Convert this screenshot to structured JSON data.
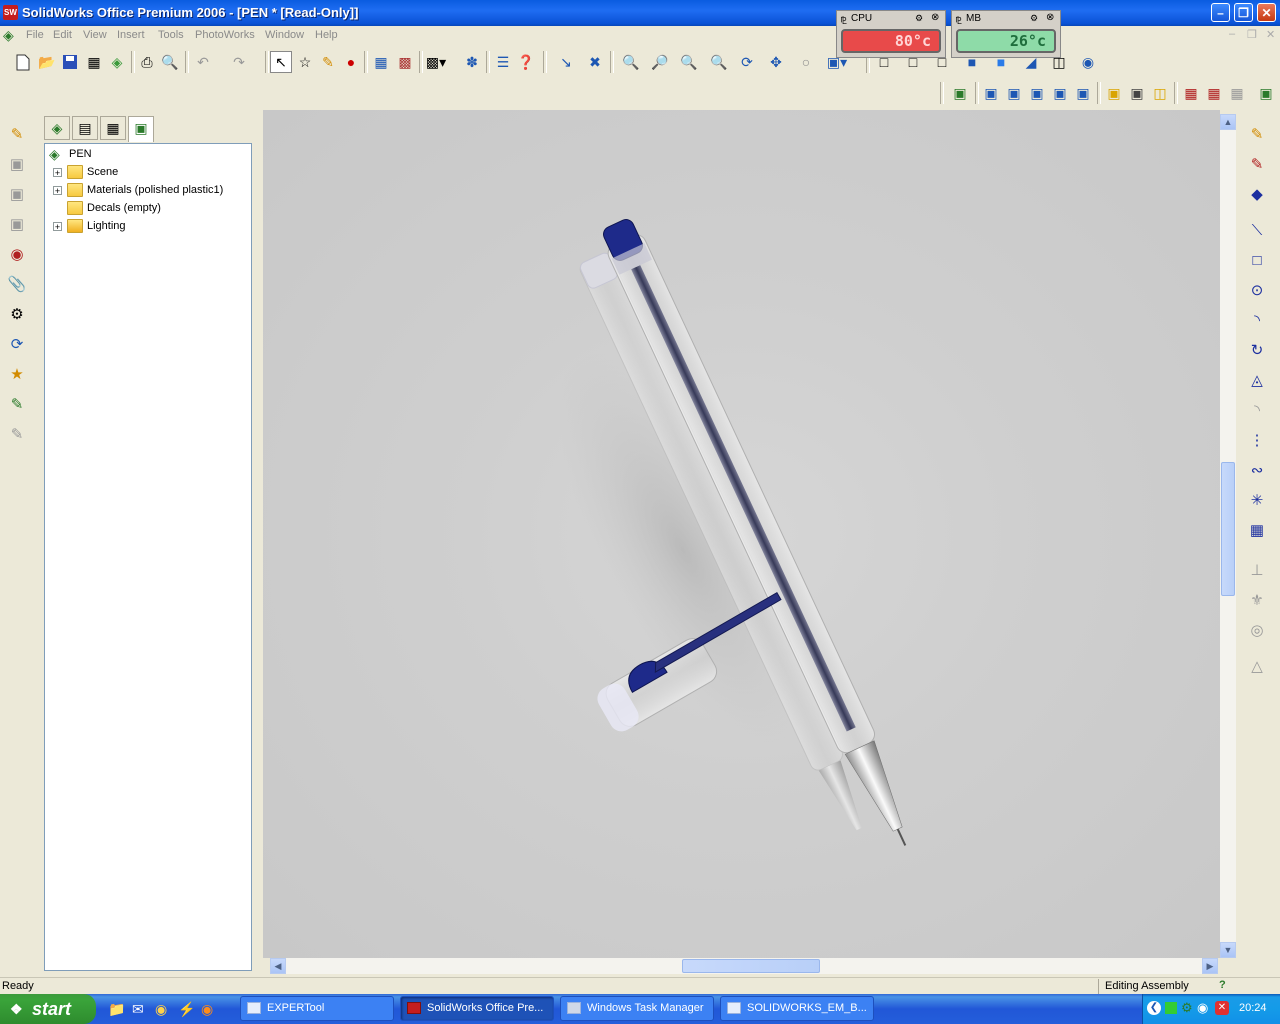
{
  "window": {
    "title": "SolidWorks Office Premium 2006 - [PEN * [Read-Only]]",
    "logo_text": "SW",
    "minimize_label": "–",
    "maximize_label": "❐",
    "close_label": "✕"
  },
  "menu": {
    "items": [
      {
        "label": "File"
      },
      {
        "label": "Edit"
      },
      {
        "label": "View"
      },
      {
        "label": "Insert"
      },
      {
        "label": "Tools"
      },
      {
        "label": "PhotoWorks"
      },
      {
        "label": "Window"
      },
      {
        "label": "Help"
      }
    ]
  },
  "gadgets": {
    "cpu": {
      "label": "CPU",
      "value": "80°c",
      "color": "#e84a4a",
      "text_color": "#ffd6d6"
    },
    "mb": {
      "label": "MB",
      "value": "26°c",
      "color": "#8edba8",
      "text_color": "#1f6e3d"
    }
  },
  "feature_tree": {
    "tabs": [
      "feature-manager",
      "property-manager",
      "configuration-manager",
      "photoworks-manager"
    ],
    "root": {
      "label": "PEN"
    },
    "items": [
      {
        "label": "Scene",
        "expandable": true
      },
      {
        "label": "Materials (polished plastic1)",
        "expandable": true
      },
      {
        "label": "Decals (empty)",
        "expandable": false
      },
      {
        "label": "Lighting",
        "expandable": true
      }
    ]
  },
  "viewport": {
    "model_name": "PEN",
    "background_color": "#cfcfcf"
  },
  "status": {
    "left": "Ready",
    "right": "Editing Assembly",
    "help_label": "?"
  },
  "taskbar": {
    "start_label": "start",
    "buttons": [
      {
        "label": "EXPERTool",
        "active": false
      },
      {
        "label": "SolidWorks Office Pre...",
        "active": true
      },
      {
        "label": "Windows Task Manager",
        "active": false
      },
      {
        "label": "SOLIDWORKS_EM_B...",
        "active": false
      }
    ],
    "clock": "20:24"
  }
}
